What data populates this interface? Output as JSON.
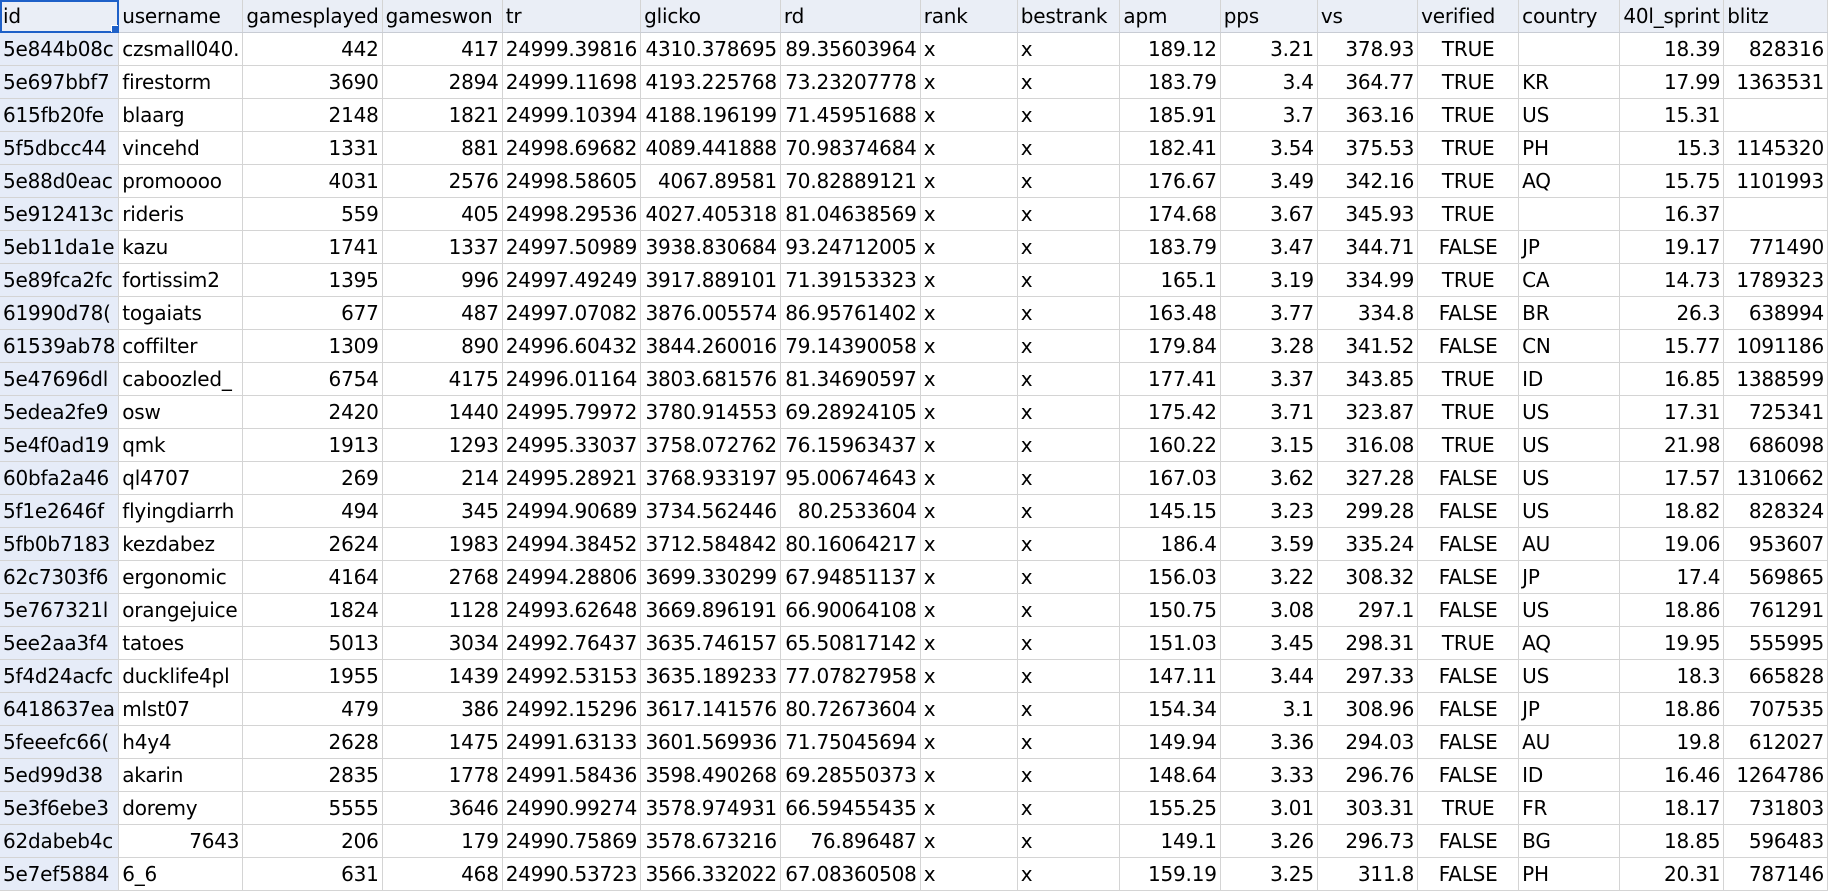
{
  "sheet": {
    "columns": [
      {
        "key": "id",
        "label": "id",
        "align": "left"
      },
      {
        "key": "username",
        "label": "username",
        "align": "left"
      },
      {
        "key": "gamesplayed",
        "label": "gamesplayed",
        "align": "num"
      },
      {
        "key": "gameswon",
        "label": "gameswon",
        "align": "num"
      },
      {
        "key": "tr",
        "label": "tr",
        "align": "num"
      },
      {
        "key": "glicko",
        "label": "glicko",
        "align": "num"
      },
      {
        "key": "rd",
        "label": "rd",
        "align": "num"
      },
      {
        "key": "rank",
        "label": "rank",
        "align": "left"
      },
      {
        "key": "bestrank",
        "label": "bestrank",
        "align": "left"
      },
      {
        "key": "apm",
        "label": "apm",
        "align": "num"
      },
      {
        "key": "pps",
        "label": "pps",
        "align": "num"
      },
      {
        "key": "vs",
        "label": "vs",
        "align": "num"
      },
      {
        "key": "verified",
        "label": "verified",
        "align": "ctr"
      },
      {
        "key": "country",
        "label": "country",
        "align": "left"
      },
      {
        "key": "sprint40l",
        "label": "40l_sprint",
        "align": "num"
      },
      {
        "key": "blitz",
        "label": "blitz",
        "align": "num"
      }
    ],
    "rows": [
      [
        "5e844b08c",
        "czsmall040.",
        "442",
        "417",
        "24999.39816",
        "4310.378695",
        "89.35603964",
        "x",
        "x",
        "189.12",
        "3.21",
        "378.93",
        "TRUE",
        "",
        "18.39",
        "828316"
      ],
      [
        "5e697bbf7",
        "firestorm",
        "3690",
        "2894",
        "24999.11698",
        "4193.225768",
        "73.23207778",
        "x",
        "x",
        "183.79",
        "3.4",
        "364.77",
        "TRUE",
        "KR",
        "17.99",
        "1363531"
      ],
      [
        "615fb20fe",
        "blaarg",
        "2148",
        "1821",
        "24999.10394",
        "4188.196199",
        "71.45951688",
        "x",
        "x",
        "185.91",
        "3.7",
        "363.16",
        "TRUE",
        "US",
        "15.31",
        ""
      ],
      [
        "5f5dbcc44",
        "vincehd",
        "1331",
        "881",
        "24998.69682",
        "4089.441888",
        "70.98374684",
        "x",
        "x",
        "182.41",
        "3.54",
        "375.53",
        "TRUE",
        "PH",
        "15.3",
        "1145320"
      ],
      [
        "5e88d0eac",
        "promoooo",
        "4031",
        "2576",
        "24998.58605",
        "4067.89581",
        "70.82889121",
        "x",
        "x",
        "176.67",
        "3.49",
        "342.16",
        "TRUE",
        "AQ",
        "15.75",
        "1101993"
      ],
      [
        "5e912413c",
        "rideris",
        "559",
        "405",
        "24998.29536",
        "4027.405318",
        "81.04638569",
        "x",
        "x",
        "174.68",
        "3.67",
        "345.93",
        "TRUE",
        "",
        "16.37",
        ""
      ],
      [
        "5eb11da1e",
        "kazu",
        "1741",
        "1337",
        "24997.50989",
        "3938.830684",
        "93.24712005",
        "x",
        "x",
        "183.79",
        "3.47",
        "344.71",
        "FALSE",
        "JP",
        "19.17",
        "771490"
      ],
      [
        "5e89fca2fc",
        "fortissim2",
        "1395",
        "996",
        "24997.49249",
        "3917.889101",
        "71.39153323",
        "x",
        "x",
        "165.1",
        "3.19",
        "334.99",
        "TRUE",
        "CA",
        "14.73",
        "1789323"
      ],
      [
        "61990d78(",
        "togaiats",
        "677",
        "487",
        "24997.07082",
        "3876.005574",
        "86.95761402",
        "x",
        "x",
        "163.48",
        "3.77",
        "334.8",
        "FALSE",
        "BR",
        "26.3",
        "638994"
      ],
      [
        "61539ab78",
        "coffilter",
        "1309",
        "890",
        "24996.60432",
        "3844.260016",
        "79.14390058",
        "x",
        "x",
        "179.84",
        "3.28",
        "341.52",
        "FALSE",
        "CN",
        "15.77",
        "1091186"
      ],
      [
        "5e47696dl",
        "caboozled_",
        "6754",
        "4175",
        "24996.01164",
        "3803.681576",
        "81.34690597",
        "x",
        "x",
        "177.41",
        "3.37",
        "343.85",
        "TRUE",
        "ID",
        "16.85",
        "1388599"
      ],
      [
        "5edea2fe9",
        "osw",
        "2420",
        "1440",
        "24995.79972",
        "3780.914553",
        "69.28924105",
        "x",
        "x",
        "175.42",
        "3.71",
        "323.87",
        "TRUE",
        "US",
        "17.31",
        "725341"
      ],
      [
        "5e4f0ad19",
        "qmk",
        "1913",
        "1293",
        "24995.33037",
        "3758.072762",
        "76.15963437",
        "x",
        "x",
        "160.22",
        "3.15",
        "316.08",
        "TRUE",
        "US",
        "21.98",
        "686098"
      ],
      [
        "60bfa2a46",
        "ql4707",
        "269",
        "214",
        "24995.28921",
        "3768.933197",
        "95.00674643",
        "x",
        "x",
        "167.03",
        "3.62",
        "327.28",
        "FALSE",
        "US",
        "17.57",
        "1310662"
      ],
      [
        "5f1e2646f",
        "flyingdiarrh",
        "494",
        "345",
        "24994.90689",
        "3734.562446",
        "80.2533604",
        "x",
        "x",
        "145.15",
        "3.23",
        "299.28",
        "FALSE",
        "US",
        "18.82",
        "828324"
      ],
      [
        "5fb0b7183",
        "kezdabez",
        "2624",
        "1983",
        "24994.38452",
        "3712.584842",
        "80.16064217",
        "x",
        "x",
        "186.4",
        "3.59",
        "335.24",
        "FALSE",
        "AU",
        "19.06",
        "953607"
      ],
      [
        "62c7303f6",
        "ergonomic",
        "4164",
        "2768",
        "24994.28806",
        "3699.330299",
        "67.94851137",
        "x",
        "x",
        "156.03",
        "3.22",
        "308.32",
        "FALSE",
        "JP",
        "17.4",
        "569865"
      ],
      [
        "5e767321l",
        "orangejuice",
        "1824",
        "1128",
        "24993.62648",
        "3669.896191",
        "66.90064108",
        "x",
        "x",
        "150.75",
        "3.08",
        "297.1",
        "FALSE",
        "US",
        "18.86",
        "761291"
      ],
      [
        "5ee2aa3f4",
        "tatoes",
        "5013",
        "3034",
        "24992.76437",
        "3635.746157",
        "65.50817142",
        "x",
        "x",
        "151.03",
        "3.45",
        "298.31",
        "TRUE",
        "AQ",
        "19.95",
        "555995"
      ],
      [
        "5f4d24acfc",
        "ducklife4pl",
        "1955",
        "1439",
        "24992.53153",
        "3635.189233",
        "77.07827958",
        "x",
        "x",
        "147.11",
        "3.44",
        "297.33",
        "FALSE",
        "US",
        "18.3",
        "665828"
      ],
      [
        "6418637ea",
        "mlst07",
        "479",
        "386",
        "24992.15296",
        "3617.141576",
        "80.72673604",
        "x",
        "x",
        "154.34",
        "3.1",
        "308.96",
        "FALSE",
        "JP",
        "18.86",
        "707535"
      ],
      [
        "5feeefc66(",
        "h4y4",
        "2628",
        "1475",
        "24991.63133",
        "3601.569936",
        "71.75045694",
        "x",
        "x",
        "149.94",
        "3.36",
        "294.03",
        "FALSE",
        "AU",
        "19.8",
        "612027"
      ],
      [
        "5ed99d38",
        "akarin",
        "2835",
        "1778",
        "24991.58436",
        "3598.490268",
        "69.28550373",
        "x",
        "x",
        "148.64",
        "3.33",
        "296.76",
        "FALSE",
        "ID",
        "16.46",
        "1264786"
      ],
      [
        "5e3f6ebe3",
        "doremy",
        "5555",
        "3646",
        "24990.99274",
        "3578.974931",
        "66.59455435",
        "x",
        "x",
        "155.25",
        "3.01",
        "303.31",
        "TRUE",
        "FR",
        "18.17",
        "731803"
      ],
      [
        "62dabeb4c",
        "7643",
        "206",
        "179",
        "24990.75869",
        "3578.673216",
        "76.896487",
        "x",
        "x",
        "149.1",
        "3.26",
        "296.73",
        "FALSE",
        "BG",
        "18.85",
        "596483"
      ],
      [
        "5e7ef5884",
        "6_6",
        "631",
        "468",
        "24990.53723",
        "3566.332022",
        "67.08360508",
        "x",
        "x",
        "159.19",
        "3.25",
        "311.8",
        "FALSE",
        "PH",
        "20.31",
        "787146"
      ]
    ],
    "numeric_usernames": [
      "7643"
    ]
  }
}
